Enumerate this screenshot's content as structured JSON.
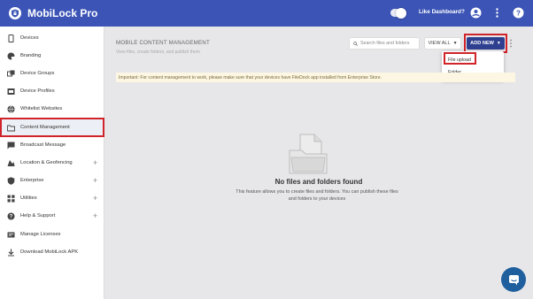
{
  "app": {
    "title": "MobiLock Pro"
  },
  "header": {
    "like_dashboard": "Like Dashboard?"
  },
  "sidebar": {
    "items": [
      {
        "label": "Devices",
        "icon": "phone-icon"
      },
      {
        "label": "Branding",
        "icon": "palette-icon"
      },
      {
        "label": "Device Groups",
        "icon": "device-groups-icon"
      },
      {
        "label": "Device Profiles",
        "icon": "device-profiles-icon"
      },
      {
        "label": "Whitelist Websites",
        "icon": "globe-icon"
      },
      {
        "label": "Content Management",
        "icon": "folder-icon"
      },
      {
        "label": "Broadcast Message",
        "icon": "message-icon"
      },
      {
        "label": "Location & Geofencing",
        "icon": "location-icon",
        "expandable": true
      },
      {
        "label": "Enterprise",
        "icon": "shield-icon",
        "expandable": true
      },
      {
        "label": "Utilities",
        "icon": "grid-icon",
        "expandable": true
      },
      {
        "label": "Help & Support",
        "icon": "help-icon",
        "expandable": true
      },
      {
        "label": "Manage Licenses",
        "icon": "license-icon"
      },
      {
        "label": "Download MobiLock APK",
        "icon": "download-icon"
      }
    ],
    "active_index": 5
  },
  "main": {
    "title": "MOBILE CONTENT MANAGEMENT",
    "subtitle": "View files, create folders, and publish them",
    "search_placeholder": "Search files and folders",
    "view_all_label": "VIEW ALL",
    "add_new_label": "ADD NEW",
    "dropdown": [
      "File upload",
      "Folder"
    ],
    "notice": "Important: For content management to work, please make sure that your devices have FileDock app installed from Enterprise Store.",
    "empty_title": "No files and folders found",
    "empty_desc": "This feature allows you to create files and folders. You can publish these files and folders to your devices"
  },
  "colors": {
    "header": "#3b54b6",
    "add_new": "#2f3f8f",
    "highlight": "#d0232a",
    "notice_bg": "#fcf6e3",
    "chat": "#1f5f9e"
  }
}
